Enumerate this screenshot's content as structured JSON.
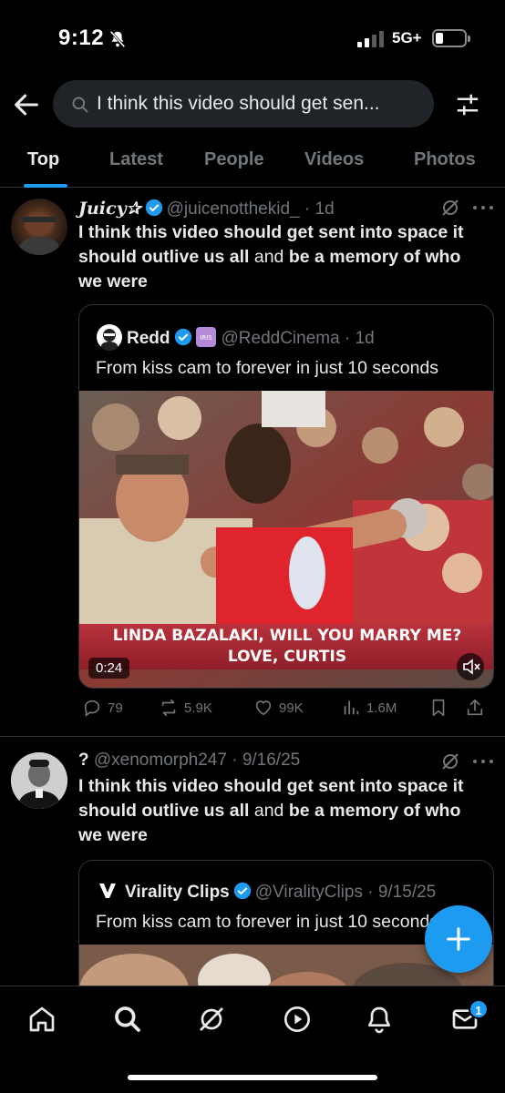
{
  "status_bar": {
    "time": "9:12",
    "network": "5G+"
  },
  "search": {
    "query": "I think this video should get sen..."
  },
  "tabs": [
    {
      "label": "Top",
      "active": true
    },
    {
      "label": "Latest"
    },
    {
      "label": "People"
    },
    {
      "label": "Videos"
    },
    {
      "label": "Photos"
    }
  ],
  "posts": [
    {
      "name": "Juicy✰",
      "handle": "@juicenotthekid_",
      "time": "· 1d",
      "text_bold_1": "I think this video should get sent into space it should outlive us all",
      "text_plain": " and ",
      "text_bold_2": "be a memory of who we were",
      "quote": {
        "name": "Redd",
        "handle": "@ReddCinema",
        "time": "· 1d",
        "text": "From kiss cam to forever in just 10 seconds",
        "video_caption_line1": "LINDA BAZALAKI, WILL YOU MARRY ME?",
        "video_caption_line2": "LOVE, CURTIS",
        "duration": "0:24"
      },
      "stats": {
        "replies": "79",
        "reposts": "5.9K",
        "likes": "99K",
        "views": "1.6M"
      }
    },
    {
      "name": "?",
      "handle": "@xenomorph247",
      "time": "· 9/16/25",
      "text_bold_1": "I think this video should get sent into space it should outlive us all",
      "text_plain": " and ",
      "text_bold_2": "be a memory of who we were",
      "quote": {
        "name": "Virality Clips",
        "handle": "@ViralityClips",
        "time": "· 9/15/25",
        "text": "From kiss cam to forever in just 10 seconds"
      }
    }
  ],
  "bottom_nav": {
    "messages_badge": "1"
  },
  "colors": {
    "accent": "#1d9bf0",
    "background": "#000000",
    "muted": "#71767b",
    "divider": "#2f3336"
  }
}
